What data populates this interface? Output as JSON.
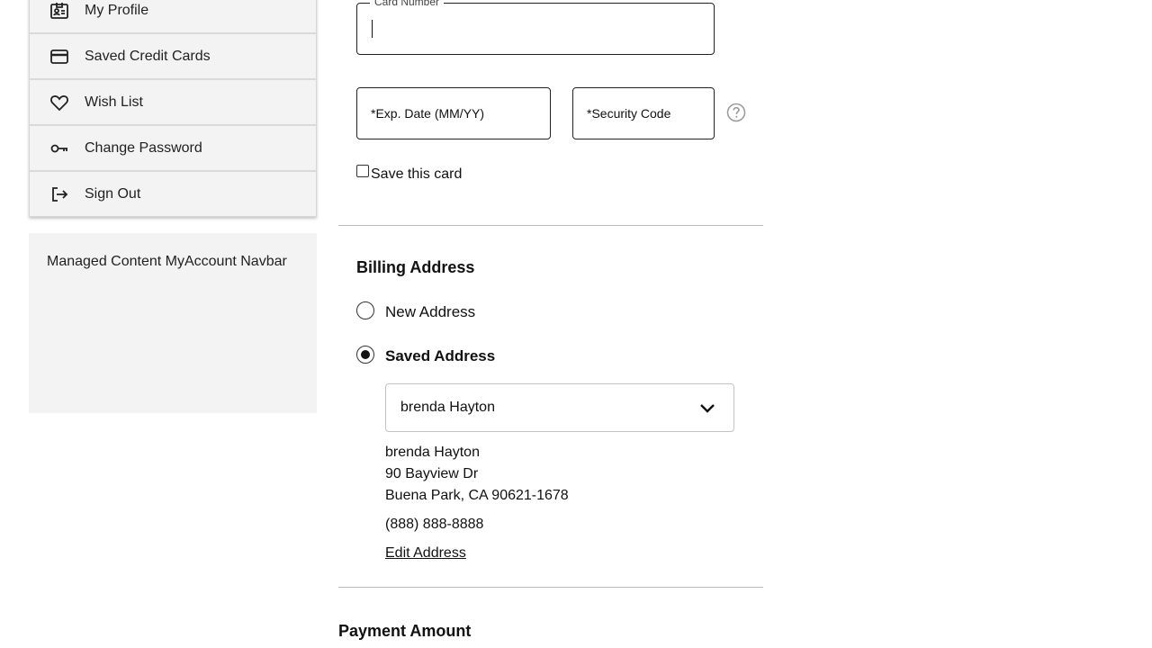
{
  "sidebar": {
    "items": [
      {
        "label": "My Profile",
        "icon": "id-badge-icon"
      },
      {
        "label": "Saved Credit Cards",
        "icon": "credit-card-icon"
      },
      {
        "label": "Wish List",
        "icon": "heart-icon"
      },
      {
        "label": "Change Password",
        "icon": "key-icon"
      },
      {
        "label": "Sign Out",
        "icon": "sign-out-icon"
      }
    ],
    "managed_content": "Managed Content MyAccount Navbar"
  },
  "card_form": {
    "card_number_label": "Card Number",
    "card_number_value": "",
    "exp_date_placeholder": "*Exp. Date (MM/YY)",
    "security_code_placeholder": "*Security Code",
    "save_card_label": "Save this card",
    "save_card_checked": false
  },
  "billing": {
    "title": "Billing Address",
    "option_new": "New Address",
    "option_saved": "Saved Address",
    "selected_option": "saved",
    "selected_address": "brenda Hayton",
    "address": {
      "name": "brenda Hayton",
      "street": "90 Bayview Dr",
      "city_line": "Buena Park, CA 90621-1678",
      "phone": "(888) 888-8888"
    },
    "edit_link": "Edit Address"
  },
  "payment": {
    "title": "Payment Amount"
  },
  "colors": {
    "panel_bg": "#f3f3f3",
    "border": "#222222",
    "divider": "#bdbdbd",
    "text": "#111111"
  }
}
